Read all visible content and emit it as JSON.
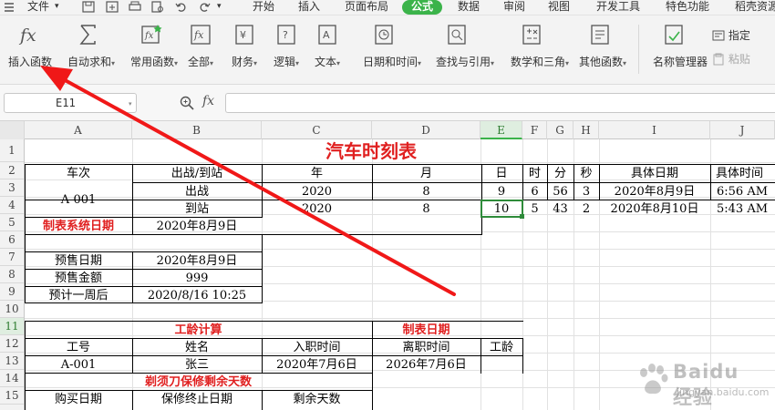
{
  "menubar": {
    "file_label": "文件",
    "tabs": [
      {
        "label": "开始"
      },
      {
        "label": "插入"
      },
      {
        "label": "页面布局"
      },
      {
        "label": "公式"
      },
      {
        "label": "数据"
      },
      {
        "label": "审阅"
      },
      {
        "label": "视图"
      },
      {
        "label": "开发工具"
      },
      {
        "label": "特色功能"
      },
      {
        "label": "稻壳资源"
      }
    ],
    "active_tab": "公式",
    "accent_color": "#3bb34a"
  },
  "ribbon": {
    "buttons": [
      {
        "label": "插入函数",
        "icon": "fx-icon"
      },
      {
        "label": "自动求和",
        "icon": "sigma-icon"
      },
      {
        "label": "常用函数",
        "icon": "star-fx-icon"
      },
      {
        "label": "全部",
        "icon": "fx-box-icon"
      },
      {
        "label": "财务",
        "icon": "finance-icon"
      },
      {
        "label": "逻辑",
        "icon": "logic-icon"
      },
      {
        "label": "文本",
        "icon": "text-icon"
      },
      {
        "label": "日期和时间",
        "icon": "clock-icon"
      },
      {
        "label": "查找与引用",
        "icon": "lookup-icon"
      },
      {
        "label": "数学和三角",
        "icon": "math-icon"
      },
      {
        "label": "其他函数",
        "icon": "book-icon"
      },
      {
        "label": "名称管理器",
        "icon": "name-manager-icon"
      }
    ],
    "small_buttons": [
      {
        "label": "指定"
      },
      {
        "label": "粘贴"
      }
    ]
  },
  "formula_bar": {
    "cell_ref": "E11",
    "formula": ""
  },
  "sheet": {
    "columns": [
      "A",
      "B",
      "C",
      "D",
      "E",
      "F",
      "G",
      "H",
      "I",
      "J"
    ],
    "rows": [
      "1",
      "2",
      "3",
      "4",
      "5",
      "6",
      "7",
      "8",
      "9",
      "10",
      "11",
      "12",
      "13",
      "14",
      "15"
    ],
    "selected_cell": "E11",
    "title": "汽车时刻表",
    "header_row": [
      "车次",
      "出战/到站",
      "年",
      "月",
      "日",
      "时",
      "分",
      "秒",
      "具体日期",
      "具体时间"
    ],
    "trips": [
      {
        "id": "A-001",
        "type": "出战",
        "year": "2020",
        "month": "8",
        "day": "9",
        "hour": "6",
        "minute": "56",
        "second": "3",
        "date": "2020年8月9日",
        "time": "6:56 AM"
      },
      {
        "type": "到站",
        "year": "2020",
        "month": "8",
        "day": "10",
        "hour": "5",
        "minute": "43",
        "second": "2",
        "date": "2020年8月10日",
        "time": "5:43 AM"
      }
    ],
    "system_date_label": "制表系统日期",
    "system_date_value": "2020年8月9日",
    "presale_date_label": "预售日期",
    "presale_date_value": "2020年8月9日",
    "presale_amount_label": "预售金额",
    "presale_amount_value": "999",
    "week_later_label": "预计一周后",
    "week_later_value": "2020/8/16 10:25",
    "seniority_title": "工龄计算",
    "table_date_label": "制表日期",
    "seniority_headers": [
      "工号",
      "姓名",
      "入职时间",
      "离职时间",
      "工龄"
    ],
    "employee": {
      "id": "A-001",
      "name": "张三",
      "hire": "2020年7月6日",
      "leave": "2026年7月6日"
    },
    "warranty_title": "剃须刀保修剩余天数",
    "warranty_headers": [
      "购买日期",
      "保修终止日期",
      "剩余天数"
    ],
    "accent_red": "#e02020"
  },
  "watermark": {
    "text": "Baidu 经验",
    "sub": "jingyan.baidu.com"
  }
}
